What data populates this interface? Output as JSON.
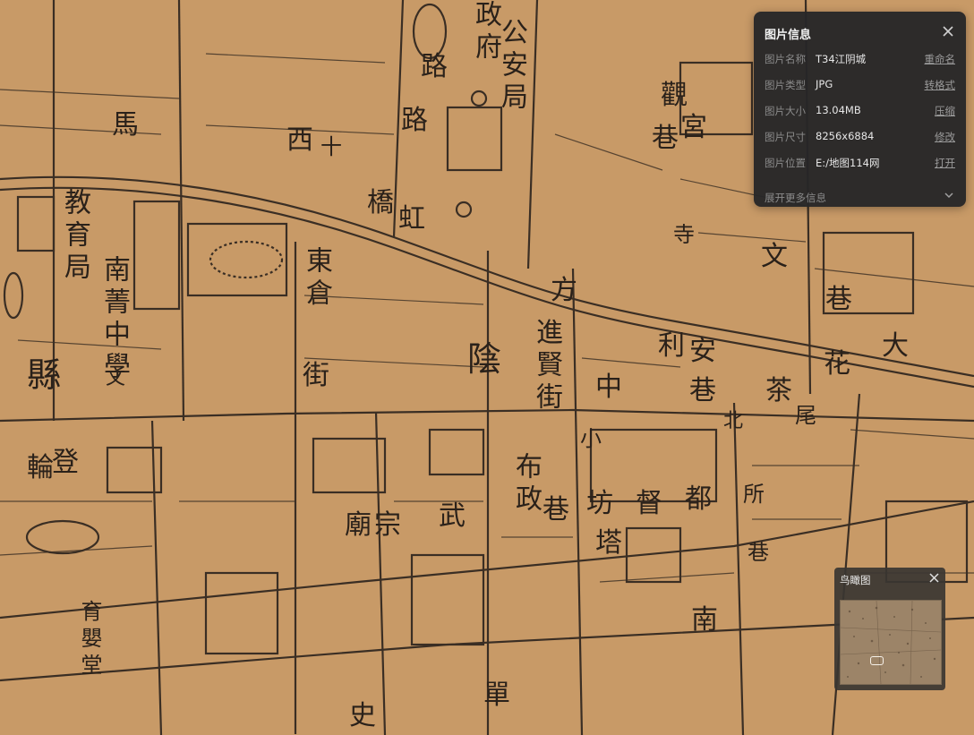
{
  "map": {
    "labels": [
      "陰",
      "縣",
      "政",
      "府",
      "公",
      "安",
      "局",
      "西",
      "十",
      "橋",
      "虹",
      "東",
      "倉",
      "街",
      "教",
      "育",
      "局",
      "南",
      "菁",
      "中",
      "學",
      "文",
      "方",
      "進",
      "賢",
      "街",
      "利",
      "安",
      "巷",
      "茶",
      "花",
      "大",
      "小",
      "坊",
      "督",
      "都",
      "布",
      "政",
      "巷",
      "武",
      "廟",
      "宗",
      "塔",
      "南",
      "單",
      "史",
      "輪",
      "登",
      "育",
      "嬰",
      "堂",
      "觀",
      "巷",
      "宮",
      "寺",
      "文",
      "巷",
      "尾",
      "北",
      "所",
      "巷",
      "中",
      "馬",
      "路",
      "路"
    ]
  },
  "info_panel": {
    "title": "图片信息",
    "rows": [
      {
        "key": "图片名称",
        "value": "T34江阴城",
        "action": "重命名"
      },
      {
        "key": "图片类型",
        "value": "JPG",
        "action": "转格式"
      },
      {
        "key": "图片大小",
        "value": "13.04MB",
        "action": "压缩"
      },
      {
        "key": "图片尺寸",
        "value": "8256x6884",
        "action": "修改"
      },
      {
        "key": "图片位置",
        "value": "E:/地图114网",
        "action": "打开"
      }
    ],
    "expand_label": "展开更多信息"
  },
  "overview": {
    "title": "鸟瞰图"
  },
  "colors": {
    "map_bg": "#c89a67",
    "ink": "#2a211a",
    "panel_bg": "#262628"
  }
}
